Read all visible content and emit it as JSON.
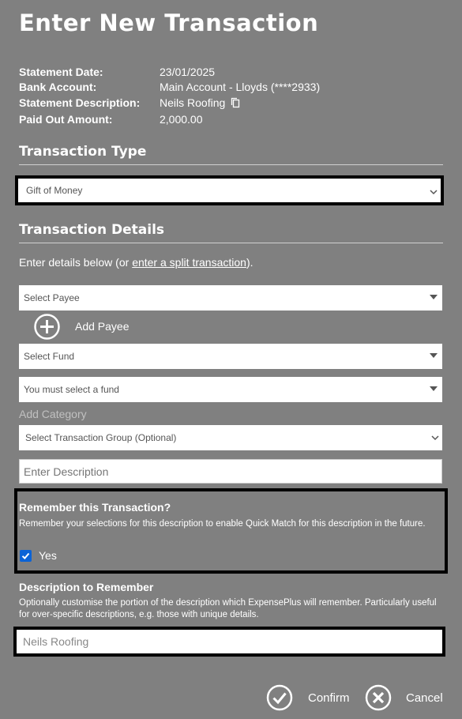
{
  "title": "Enter New Transaction",
  "summary": [
    {
      "label": "Statement Date:",
      "value": "23/01/2025"
    },
    {
      "label": "Bank Account:",
      "value": "Main Account - Lloyds (****2933)"
    },
    {
      "label": "Statement Description:",
      "value": "Neils Roofing"
    },
    {
      "label": "Paid Out Amount:",
      "value": "2,000.00"
    }
  ],
  "transaction_type": {
    "heading": "Transaction Type",
    "selected": "Gift of Money"
  },
  "details": {
    "heading": "Transaction Details",
    "intro_prefix": "Enter details below (or ",
    "intro_link": "enter a split transaction",
    "intro_suffix": ").",
    "payee_placeholder": "Select Payee",
    "add_payee_label": "Add Payee",
    "fund_placeholder": "Select Fund",
    "fund_warning": "You must select a fund",
    "add_category_label": "Add Category",
    "group_placeholder": "Select Transaction Group (Optional)",
    "description_placeholder": "Enter Description"
  },
  "remember": {
    "heading": "Remember this Transaction?",
    "text": "Remember your selections for this description to enable Quick Match for this description in the future.",
    "checkbox_label": "Yes",
    "checked": true
  },
  "description_to_remember": {
    "heading": "Description to Remember",
    "text": "Optionally customise the portion of the description which ExpensePlus will remember. Particularly useful for over-specific descriptions, e.g. those with unique details.",
    "value": "Neils Roofing"
  },
  "footer": {
    "confirm_label": "Confirm",
    "cancel_label": "Cancel"
  },
  "colors": {
    "background": "#808080",
    "outline": "#000000",
    "checkbox": "#0b63d6"
  }
}
